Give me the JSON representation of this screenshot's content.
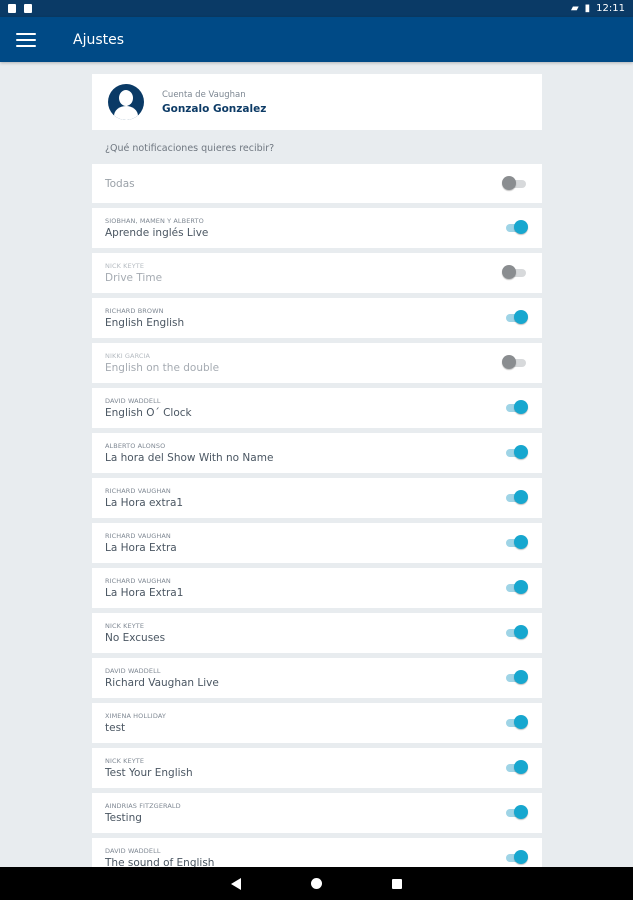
{
  "status_bar": {
    "time": "12:11"
  },
  "app_bar": {
    "title": "Ajustes"
  },
  "account": {
    "label": "Cuenta de Vaughan",
    "name": "Gonzalo Gonzalez"
  },
  "notifications": {
    "question": "¿Qué notificaciones quieres recibir?",
    "all": {
      "label": "Todas",
      "enabled": false
    },
    "items": [
      {
        "owner": "SIOBHAN, MAMEN Y ALBERTO",
        "title": "Aprende inglés Live",
        "enabled": true
      },
      {
        "owner": "NICK KEYTE",
        "title": "Drive Time",
        "enabled": false
      },
      {
        "owner": "RICHARD BROWN",
        "title": "English English",
        "enabled": true
      },
      {
        "owner": "NIKKI GARCIA",
        "title": "English on the double",
        "enabled": false
      },
      {
        "owner": "DAVID WADDELL",
        "title": "English O´ Clock",
        "enabled": true
      },
      {
        "owner": "ALBERTO ALONSO",
        "title": "La hora del Show With no Name",
        "enabled": true
      },
      {
        "owner": "RICHARD VAUGHAN",
        "title": "La Hora extra1",
        "enabled": true
      },
      {
        "owner": "RICHARD VAUGHAN",
        "title": "La Hora Extra",
        "enabled": true
      },
      {
        "owner": "RICHARD VAUGHAN",
        "title": "La Hora Extra1",
        "enabled": true
      },
      {
        "owner": "NICK KEYTE",
        "title": "No Excuses",
        "enabled": true
      },
      {
        "owner": "DAVID WADDELL",
        "title": "Richard Vaughan Live",
        "enabled": true
      },
      {
        "owner": "XIMENA HOLLIDAY",
        "title": "test",
        "enabled": true
      },
      {
        "owner": "NICK KEYTE",
        "title": "Test Your English",
        "enabled": true
      },
      {
        "owner": "AINDRIAS FITZGERALD",
        "title": "Testing",
        "enabled": true
      },
      {
        "owner": "DAVID WADDELL",
        "title": "The sound of English",
        "enabled": true
      }
    ]
  },
  "colors": {
    "app_bar": "#004a86",
    "status_bar": "#0a3a66",
    "toggle_on": "#17a7cf",
    "toggle_off": "#8a8d90"
  }
}
